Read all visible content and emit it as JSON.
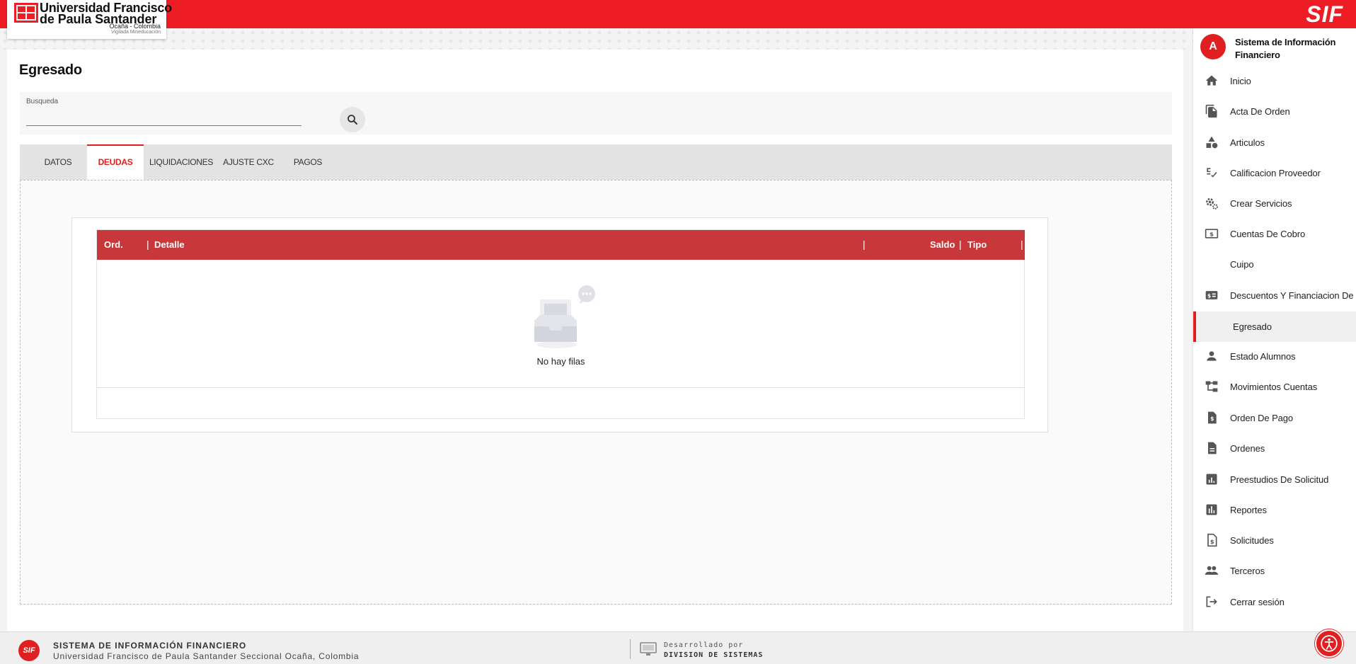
{
  "header": {
    "logo_line1": "Universidad Francisco",
    "logo_line2": "de Paula Santander",
    "logo_line3": "Ocaña - Colombia",
    "logo_line4": "Vigilada Mineducación",
    "brand": "SIF",
    "accent_color": "#ee1d24"
  },
  "main": {
    "title": "Egresado",
    "search": {
      "label": "Busqueda",
      "value": "",
      "placeholder": ""
    },
    "tabs": [
      {
        "label": "DATOS",
        "active": false
      },
      {
        "label": "DEUDAS",
        "active": true
      },
      {
        "label": "LIQUIDACIONES",
        "active": false
      },
      {
        "label": "AJUSTE CXC",
        "active": false
      },
      {
        "label": "PAGOS",
        "active": false
      }
    ],
    "grid": {
      "columns": [
        "Ord.",
        "Detalle",
        "Saldo",
        "Tipo"
      ],
      "rows": [],
      "empty_text": "No hay filas"
    }
  },
  "sidebar": {
    "avatar_letter": "A",
    "title": "Sistema de Información Financiero",
    "items": [
      {
        "label": "Inicio",
        "icon": "home-icon",
        "active": false
      },
      {
        "label": "Acta De Orden",
        "icon": "file-copy-icon",
        "active": false
      },
      {
        "label": "Articulos",
        "icon": "category-icon",
        "active": false
      },
      {
        "label": "Calificacion Proveedor",
        "icon": "rating-check-icon",
        "active": false
      },
      {
        "label": "Crear Servicios",
        "icon": "gears-icon",
        "active": false
      },
      {
        "label": "Cuentas De Cobro",
        "icon": "money-icon",
        "active": false
      },
      {
        "label": "Cuipo",
        "icon": "",
        "active": false
      },
      {
        "label": "Descuentos Y Financiacion De",
        "icon": "discount-money-icon",
        "active": false
      },
      {
        "label": "Egresado",
        "icon": "",
        "active": true
      },
      {
        "label": "Estado Alumnos",
        "icon": "person-icon",
        "active": false
      },
      {
        "label": "Movimientos Cuentas",
        "icon": "account-tree-icon",
        "active": false
      },
      {
        "label": "Orden De Pago",
        "icon": "invoice-dollar-icon",
        "active": false
      },
      {
        "label": "Ordenes",
        "icon": "description-icon",
        "active": false
      },
      {
        "label": "Preestudios De Solicitud",
        "icon": "chart-box-icon",
        "active": false
      },
      {
        "label": "Reportes",
        "icon": "bar-chart-icon",
        "active": false
      },
      {
        "label": "Solicitudes",
        "icon": "request-quote-icon",
        "active": false
      },
      {
        "label": "Terceros",
        "icon": "group-icon",
        "active": false
      },
      {
        "label": "Cerrar sesión",
        "icon": "logout-icon",
        "active": false
      }
    ]
  },
  "footer": {
    "title": "SISTEMA DE INFORMACIÓN FINANCIERO",
    "subtitle": "Universidad Francisco de Paula Santander Seccional Ocaña, Colombia",
    "logo_text": "SIF",
    "dev_label": "Desarrollado por",
    "dev_name": "DIVISION DE SISTEMAS"
  }
}
